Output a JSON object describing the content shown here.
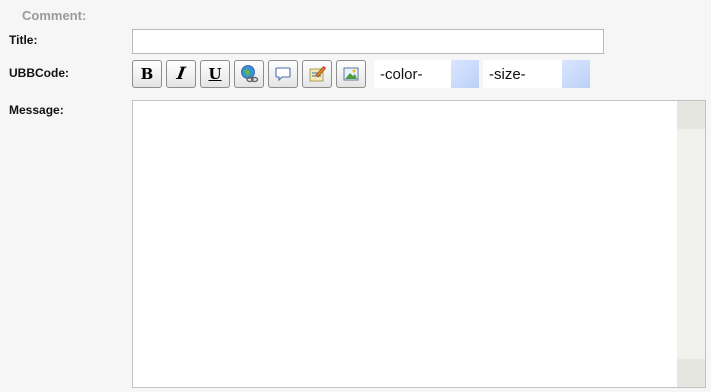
{
  "form": {
    "heading": "Comment:",
    "title_label": "Title:",
    "ubbcode_label": "UBBCode:",
    "message_label": "Message:",
    "title_value": "",
    "message_value": ""
  },
  "toolbar": {
    "bold_label": "B",
    "italic_label": "I",
    "underline_label": "U",
    "buttons": [
      {
        "name": "bold",
        "icon": "bold-icon"
      },
      {
        "name": "italic",
        "icon": "italic-icon"
      },
      {
        "name": "underline",
        "icon": "underline-icon"
      },
      {
        "name": "link",
        "icon": "globe-link-icon"
      },
      {
        "name": "quote",
        "icon": "speech-bubble-icon"
      },
      {
        "name": "edit",
        "icon": "edit-pencil-icon"
      },
      {
        "name": "image",
        "icon": "image-icon"
      }
    ],
    "color_select": "-color-",
    "size_select": "-size-"
  },
  "colors": {
    "select_arrow": "#bcd0f7",
    "background": "#f6f6f6",
    "heading": "#9a9a9a"
  }
}
